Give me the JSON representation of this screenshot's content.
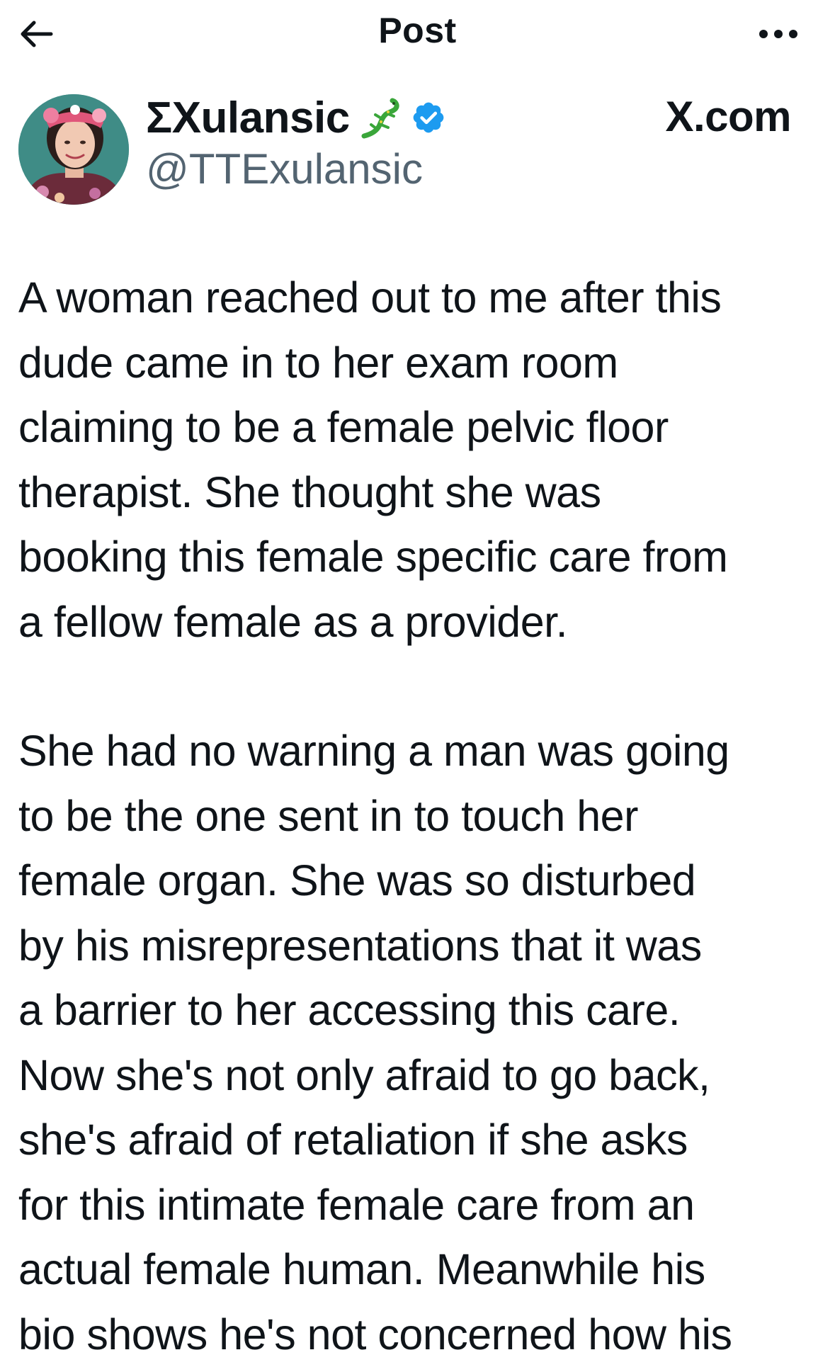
{
  "topbar": {
    "title": "Post",
    "back_icon": "arrow-left-icon",
    "more_icon": "more-horizontal-icon"
  },
  "author": {
    "display_name": "ΣXulansic",
    "handle": "@TTExulansic",
    "name_emoji_icon": "lizard-icon",
    "verified_icon": "verified-badge-icon",
    "verified_color": "#1d9bf0"
  },
  "brand": {
    "label": "X.com"
  },
  "post": {
    "paragraph1": [
      "A woman reached out to me after this",
      "dude came in to her exam room",
      "claiming to be a female pelvic floor",
      "therapist. She thought she was",
      "booking this female specific care from",
      "a fellow female as a provider."
    ],
    "paragraph2": [
      "She had no warning a man was going",
      "to be the one sent in to touch her",
      "female organ. She was so disturbed",
      "by his misrepresentations that it was",
      "a barrier to her accessing this care.",
      "Now she's not only afraid to go back,",
      "she's afraid of retaliation if she asks",
      "for this intimate female care from an",
      "actual female human. Meanwhile his",
      "bio shows he's not concerned how his"
    ]
  },
  "colors": {
    "text": "#0f1419",
    "secondary_text": "#536471",
    "background": "#ffffff"
  }
}
